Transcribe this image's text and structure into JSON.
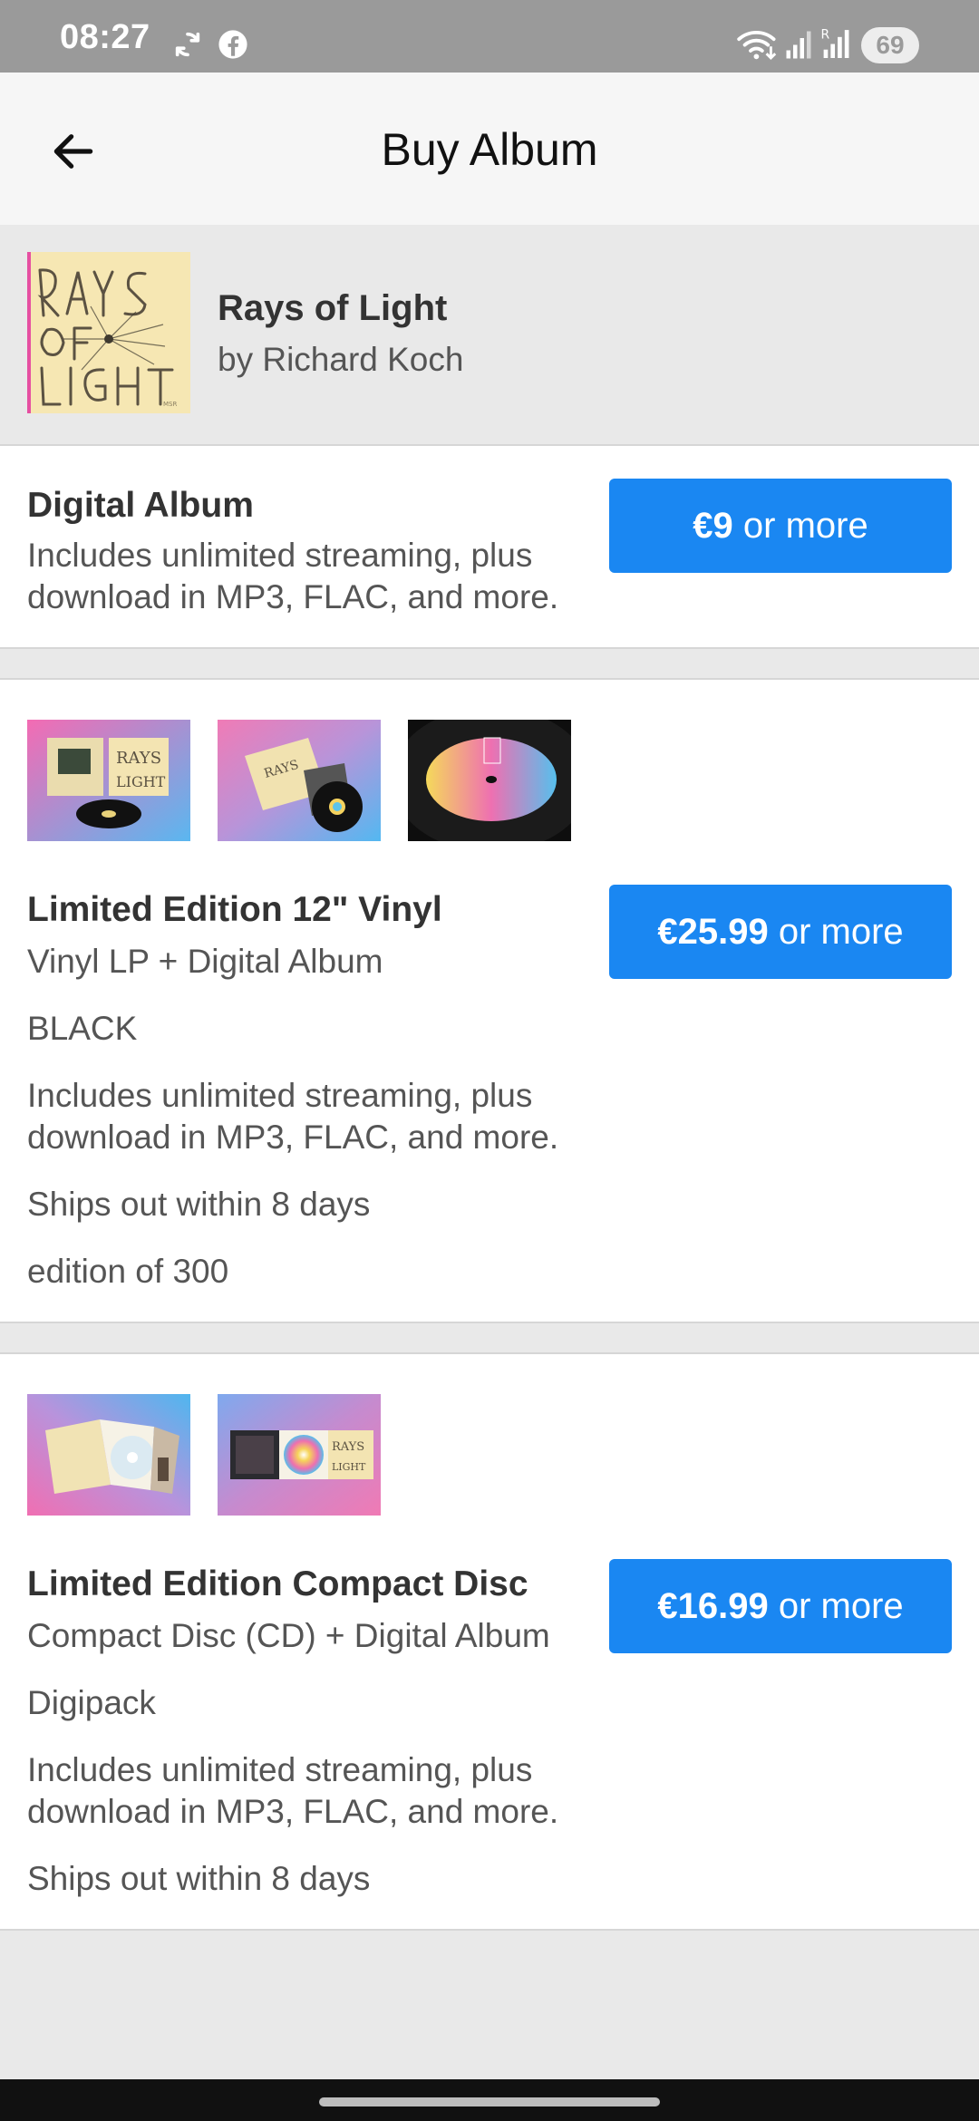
{
  "status_bar": {
    "time": "08:27",
    "battery": "69",
    "icons": [
      "sync-icon",
      "facebook-icon",
      "wifi-icon",
      "signal-icon",
      "signal-roaming-icon",
      "battery-icon"
    ]
  },
  "app_bar": {
    "title": "Buy Album",
    "back_icon": "arrow-left-icon"
  },
  "album": {
    "title": "Rays of Light",
    "artist": "by Richard Koch",
    "cover_text": "RAYS OF LIGHT"
  },
  "digital": {
    "title": "Digital Album",
    "line1": "Includes unlimited streaming, plus",
    "line2": "download in MP3, FLAC, and more.",
    "price": "€9",
    "price_suffix": " or more"
  },
  "vinyl": {
    "title": "Limited Edition 12\" Vinyl",
    "format": "Vinyl LP + Digital Album",
    "variant": "BLACK",
    "line1": "Includes unlimited streaming, plus",
    "line2": "download in MP3, FLAC, and more.",
    "shipping": "Ships out within 8 days",
    "edition": "edition of 300",
    "price": "€25.99",
    "price_suffix": " or more"
  },
  "cd": {
    "title": "Limited Edition Compact Disc",
    "format": "Compact Disc (CD) + Digital Album",
    "variant": "Digipack",
    "line1": "Includes unlimited streaming, plus",
    "line2": "download in MP3, FLAC, and more.",
    "shipping": "Ships out within 8 days",
    "price": "€16.99",
    "price_suffix": " or more"
  },
  "colors": {
    "accent": "#1a87f2",
    "status_bar": "#9a9a9a",
    "background": "#e9e9e9"
  }
}
